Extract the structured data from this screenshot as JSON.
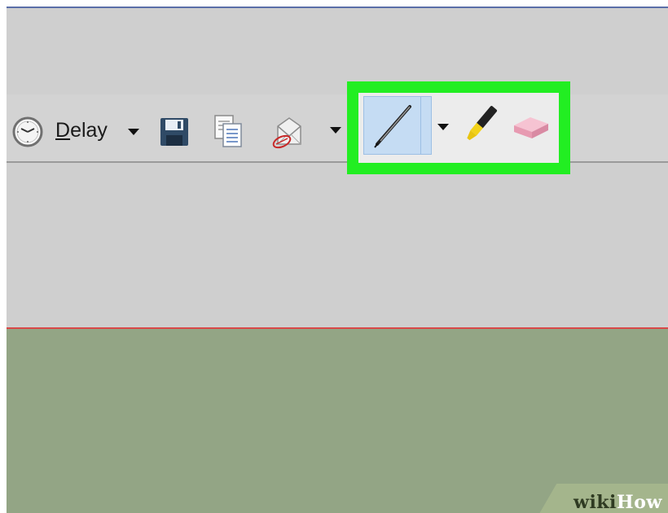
{
  "toolbar": {
    "delay_label_underlined": "D",
    "delay_label_rest": "elay",
    "icons": [
      "clock-icon",
      "dropdown-arrow-icon",
      "save-icon",
      "copy-icon",
      "send-email-icon",
      "dropdown-arrow-icon",
      "pen-icon",
      "dropdown-arrow-icon",
      "highlighter-icon",
      "eraser-icon"
    ]
  },
  "watermark": {
    "wiki": "wiki",
    "how": "How"
  },
  "colors": {
    "highlight_box": "#22ee22",
    "pen_selected_bg": "#c5dcf3",
    "canvas": "#93a585",
    "toolbar": "#d3d3d3",
    "canvas_border": "#d84848"
  }
}
